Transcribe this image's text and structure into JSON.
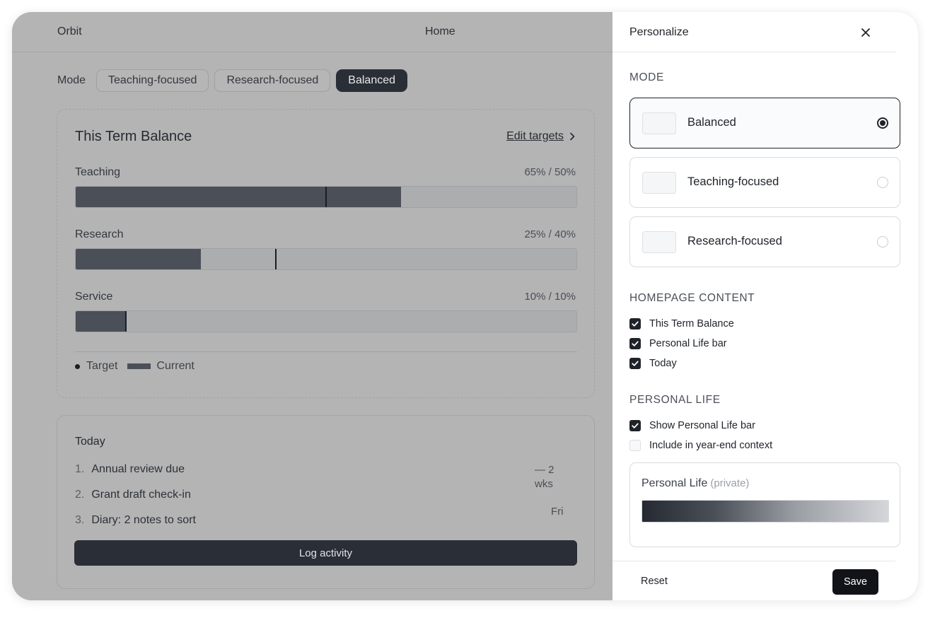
{
  "header": {
    "brand": "Orbit",
    "page_title": "Home"
  },
  "mode_bar": {
    "label": "Mode",
    "options": [
      "Teaching-focused",
      "Research-focused",
      "Balanced"
    ],
    "active": "Balanced"
  },
  "balance_card": {
    "title": "This Term Balance",
    "edit_label": "Edit targets",
    "metrics": [
      {
        "name": "Teaching",
        "values_text": "65% / 50%",
        "current": 65,
        "target": 50
      },
      {
        "name": "Research",
        "values_text": "25% / 40%",
        "current": 25,
        "target": 40
      },
      {
        "name": "Service",
        "values_text": "10% / 10%",
        "current": 10,
        "target": 10
      }
    ],
    "legend": {
      "target": "Target",
      "current": "Current"
    }
  },
  "today_card": {
    "title": "Today",
    "items": [
      {
        "num": "1.",
        "text": "Annual review due"
      },
      {
        "num": "2.",
        "text": "Grant draft check-in"
      },
      {
        "num": "3.",
        "text": "Diary: 2 notes to sort"
      }
    ],
    "due_a": "— 2 wks",
    "due_b": "Fri",
    "log_label": "Log activity"
  },
  "panel": {
    "title": "Personalize",
    "mode_section": "MODE",
    "mode_options": [
      {
        "label": "Balanced",
        "selected": true
      },
      {
        "label": "Teaching-focused",
        "selected": false
      },
      {
        "label": "Research-focused",
        "selected": false
      }
    ],
    "homepage_section": "HOMEPAGE CONTENT",
    "homepage_items": [
      {
        "label": "This Term Balance",
        "checked": true
      },
      {
        "label": "Personal Life bar",
        "checked": true
      },
      {
        "label": "Today",
        "checked": true
      }
    ],
    "personal_section": "PERSONAL LIFE",
    "personal_items": [
      {
        "label": "Show Personal Life bar",
        "checked": true
      },
      {
        "label": "Include in year-end context",
        "checked": false
      }
    ],
    "personal_card": {
      "title": "Personal Life",
      "private": "(private)"
    },
    "reset_label": "Reset",
    "save_label": "Save"
  },
  "colors": {
    "accent_dark": "#2a2e36",
    "fill": "#4a4f58",
    "overlay": "#b4b4b5",
    "panel_bg": "#ffffff"
  },
  "icons": {
    "close": "close-icon",
    "chevron": "chevron-right-icon",
    "check": "check-icon"
  }
}
